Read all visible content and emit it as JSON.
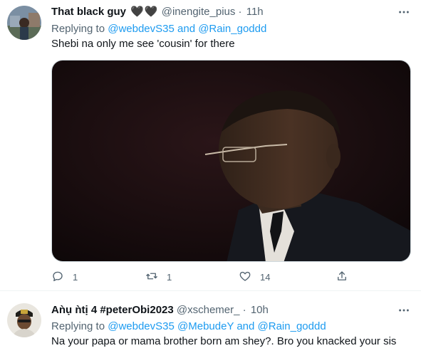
{
  "tweets": [
    {
      "display_name": "That black guy",
      "badges": "🖤🖤",
      "handle": "@inengite_pius",
      "dot": "·",
      "time": "11h",
      "replying_prefix": "Replying to",
      "replying_mentions": "@webdevS35 and @Rain_goddd",
      "text": "Shebi na only me see 'cousin' for there",
      "media": {
        "type": "video-still",
        "description_icon": "person-image"
      },
      "actions": {
        "reply_count": "1",
        "retweet_count": "1",
        "like_count": "14",
        "share_count": ""
      }
    },
    {
      "display_name": "Aǹụ ǹtị 4 #peterObi2023",
      "handle": "@xschemer_",
      "dot": "·",
      "time": "10h",
      "replying_prefix": "Replying to",
      "replying_mentions": "@webdevS35 @MebudeY and @Rain_goddd",
      "text": "Na your papa or mama brother born am shey?. Bro you knacked your sis"
    }
  ],
  "icons": {
    "more": "more-horizontal-icon",
    "reply": "reply-icon",
    "retweet": "retweet-icon",
    "like": "heart-icon",
    "share": "share-icon"
  },
  "colors": {
    "text_primary": "#0f1419",
    "text_secondary": "#536471",
    "link": "#1d9bf0",
    "border": "#eff3f4"
  }
}
